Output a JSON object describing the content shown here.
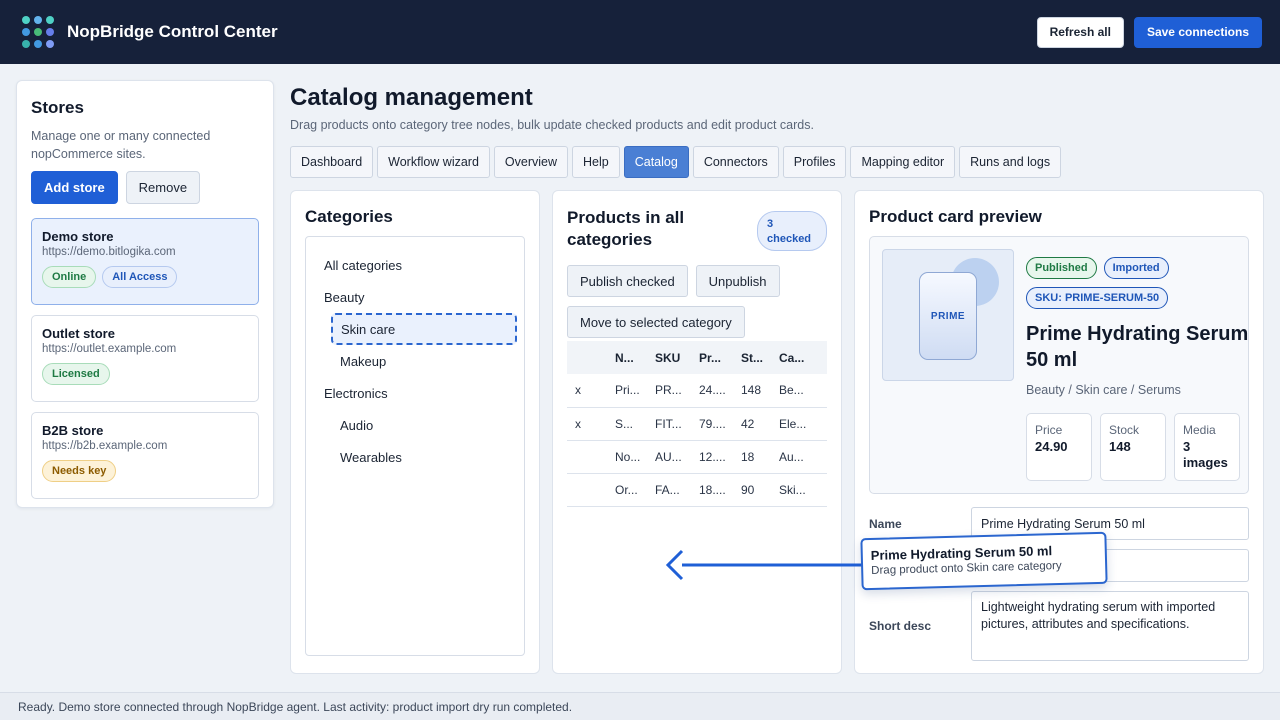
{
  "app": {
    "title": "NopBridge Control Center",
    "logo_colors": [
      "#4fd1c5",
      "#63b3ed",
      "#4fd1c5",
      "#4299e1",
      "#48bb78",
      "#667eea",
      "#38b2ac",
      "#4299e1",
      "#7f9cf5"
    ]
  },
  "header": {
    "refresh_label": "Refresh all",
    "save_label": "Save connections"
  },
  "stores": {
    "title": "Stores",
    "description": "Manage one or many connected nopCommerce sites.",
    "add_label": "Add store",
    "remove_label": "Remove",
    "items": [
      {
        "name": "Demo store",
        "url": "https://demo.bitlogika.com",
        "badges": [
          "Online",
          "All Access"
        ]
      },
      {
        "name": "Outlet store",
        "url": "https://outlet.example.com",
        "badges": [
          "Licensed"
        ]
      },
      {
        "name": "B2B store",
        "url": "https://b2b.example.com",
        "badges": [
          "Needs key"
        ]
      }
    ]
  },
  "main": {
    "title": "Catalog management",
    "subtitle": "Drag products onto category tree nodes, bulk update checked products and edit product cards.",
    "tabs": [
      "Dashboard",
      "Workflow wizard",
      "Overview",
      "Help",
      "Catalog",
      "Connectors",
      "Profiles",
      "Mapping editor",
      "Runs and logs"
    ],
    "active_tab": "Catalog"
  },
  "categories": {
    "title": "Categories",
    "nodes": [
      "All categories",
      "Beauty",
      "Skin care",
      "Makeup",
      "Electronics",
      "Audio",
      "Wearables"
    ]
  },
  "products": {
    "title": "Products in all categories",
    "checked_pill": "3 checked",
    "publish_label": "Publish checked",
    "unpublish_label": "Unpublish",
    "move_label": "Move to selected category",
    "columns": [
      "",
      "N...",
      "SKU",
      "Pr...",
      "St...",
      "Ca..."
    ],
    "rows": [
      [
        "x",
        "Pri...",
        "PR...",
        "24....",
        "148",
        "Be..."
      ],
      [
        "x",
        "S...",
        "FIT...",
        "79....",
        "42",
        "Ele..."
      ],
      [
        "",
        "No...",
        "AU...",
        "12....",
        "18",
        "Au..."
      ],
      [
        "",
        "Or...",
        "FA...",
        "18....",
        "90",
        "Ski..."
      ]
    ]
  },
  "preview": {
    "title": "Product card preview",
    "badge_published": "Published",
    "badge_imported": "Imported",
    "sku_badge": "SKU: PRIME-SERUM-50",
    "bottle_label": "PRIME",
    "product_name": "Prime Hydrating Serum 50 ml",
    "category_path": "Beauty / Skin care / Serums",
    "stats": [
      {
        "k": "Price",
        "v": "24.90"
      },
      {
        "k": "Stock",
        "v": "148"
      },
      {
        "k": "Media",
        "v": "3 images"
      }
    ],
    "form": {
      "name_label": "Name",
      "name_value": "Prime Hydrating Serum 50 ml",
      "short_label": "Short desc",
      "short_value": "Lightweight hydrating serum with imported pictures, attributes and specifications."
    }
  },
  "drag": {
    "title": "Prime Hydrating Serum 50 ml",
    "hint": "Drag product onto Skin care category"
  },
  "status": {
    "text": "Ready. Demo store connected through NopBridge agent. Last activity: product import dry run completed."
  }
}
